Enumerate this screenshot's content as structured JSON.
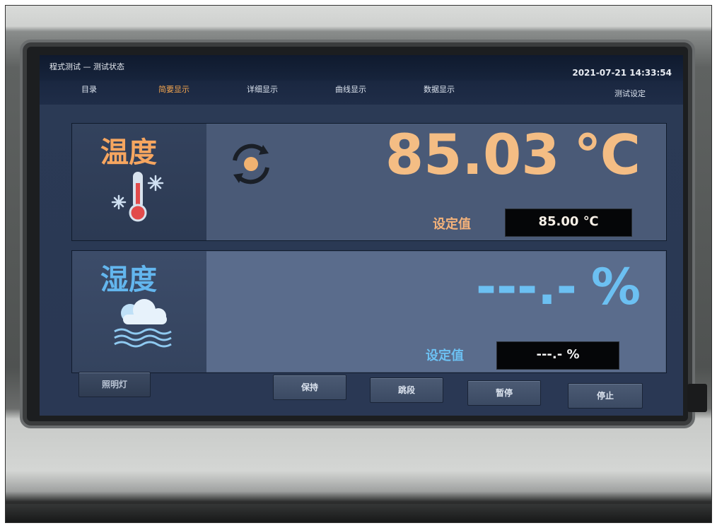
{
  "header": {
    "title": "程式测试 — 测试状态",
    "datetime": "2021-07-21 14:33:54"
  },
  "tabs": [
    {
      "label": "目录",
      "active": false
    },
    {
      "label": "简要显示",
      "active": true
    },
    {
      "label": "详细显示",
      "active": false
    },
    {
      "label": "曲线显示",
      "active": false
    },
    {
      "label": "数据显示",
      "active": false
    },
    {
      "label": "测试设定",
      "active": false
    }
  ],
  "temperature": {
    "label": "温度",
    "value": "85.03",
    "unit": "℃",
    "setpoint_label": "设定值",
    "setpoint": "85.00 ℃",
    "color": "#f6a660"
  },
  "humidity": {
    "label": "湿度",
    "value": "---.-",
    "unit": "%",
    "setpoint_label": "设定值",
    "setpoint": "---.- %",
    "color": "#63b6ee"
  },
  "buttons": {
    "light": "照明灯",
    "hold": "保持",
    "skip": "跳段",
    "pause": "暂停",
    "stop": "停止"
  },
  "icons": {
    "temperature": "thermometer-snowflake-icon",
    "humidity": "cloud-waves-icon",
    "status": "refresh-cycle-icon"
  }
}
